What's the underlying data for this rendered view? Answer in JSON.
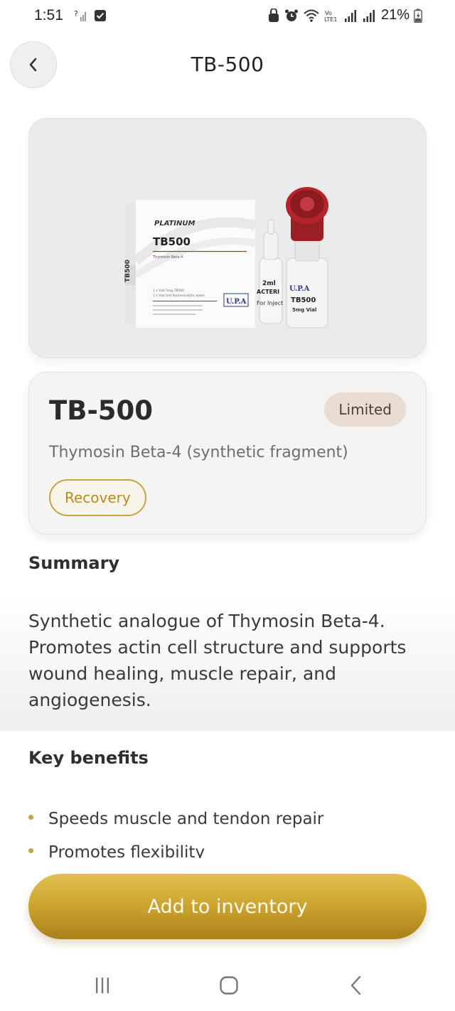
{
  "status_bar": {
    "time": "1:51",
    "battery": "21%",
    "icons": [
      "signal-unknown-icon",
      "checkbox-notification-icon",
      "alarm-lock-icon",
      "alarm-icon",
      "wifi-icon",
      "volte-icon",
      "signal-bars-icon",
      "signal-bars-icon",
      "battery-charging-icon"
    ]
  },
  "header": {
    "title": "TB-500",
    "back_icon": "chevron-left-icon"
  },
  "product": {
    "name": "TB-500",
    "availability": "Limited",
    "subtitle": "Thymosin Beta-4 (synthetic fragment)",
    "category": "Recovery",
    "image_labels": {
      "box_brand": "PLATINUM",
      "box_name": "TB500",
      "box_sub": "Thymosin Beta-4",
      "box_side": "TB500",
      "box_line1": "1 x Vial 5mg TB500",
      "box_line2": "1 x Vial 2ml Bacteriostatic water",
      "logo": "U.P.A",
      "amp_line1": "2ml",
      "amp_line2": "ACTERI",
      "amp_line3": "For Inject",
      "vial_name": "TB500",
      "vial_dose": "5mg Vial"
    }
  },
  "summary": {
    "heading": "Summary",
    "text": "Synthetic analogue of Thymosin Beta-4. Promotes actin cell structure and supports wound healing, muscle repair, and angiogenesis."
  },
  "benefits": {
    "heading": "Key benefits",
    "items": [
      "Speeds muscle and tendon repair",
      "Promotes flexibility"
    ]
  },
  "actions": {
    "add_label": "Add to inventory"
  },
  "colors": {
    "accent_gold": "#c9a33b",
    "badge_bg": "#ebdcd2",
    "card_bg": "#f4f4f4"
  },
  "nav": {
    "items": [
      "recent-apps-icon",
      "home-icon",
      "back-icon"
    ]
  }
}
